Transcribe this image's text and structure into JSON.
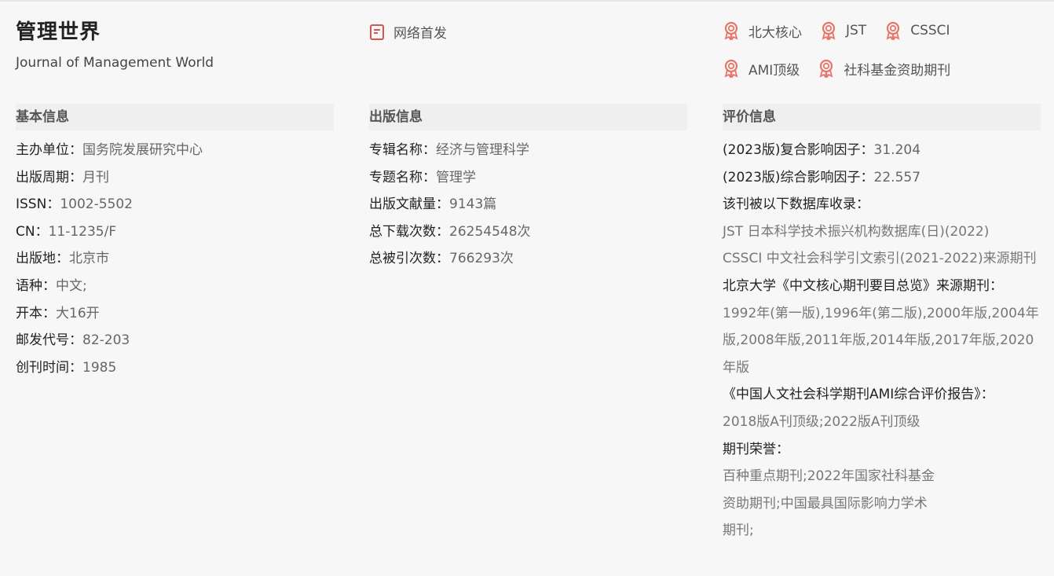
{
  "journal": {
    "title": "管理世界",
    "subtitle": "Journal of Management World",
    "network_first": "网络首发"
  },
  "badges": {
    "row1": [
      "北大核心",
      "JST",
      "CSSCI"
    ],
    "row2": [
      "AMI顶级",
      "社科基金资助期刊"
    ],
    "accent": "#e8756a"
  },
  "basic": {
    "heading": "基本信息",
    "items": [
      {
        "k": "主办单位：",
        "v": "国务院发展研究中心"
      },
      {
        "k": "出版周期：",
        "v": "月刊"
      },
      {
        "k": "ISSN：",
        "v": "1002-5502"
      },
      {
        "k": "CN：",
        "v": "11-1235/F"
      },
      {
        "k": "出版地：",
        "v": "北京市"
      },
      {
        "k": "语种：",
        "v": "中文;"
      },
      {
        "k": "开本：",
        "v": "大16开"
      },
      {
        "k": "邮发代号：",
        "v": "82-203"
      },
      {
        "k": "创刊时间：",
        "v": "1985"
      }
    ]
  },
  "publish": {
    "heading": "出版信息",
    "items": [
      {
        "k": "专辑名称：",
        "v": "经济与管理科学"
      },
      {
        "k": "专题名称：",
        "v": "管理学"
      },
      {
        "k": "出版文献量：",
        "v": "9143篇"
      },
      {
        "k": "总下载次数：",
        "v": "26254548次"
      },
      {
        "k": "总被引次数：",
        "v": "766293次"
      }
    ]
  },
  "evaluation": {
    "heading": "评价信息",
    "composite_if_k": "(2023版)复合影响因子：",
    "composite_if_v": "31.204",
    "comprehensive_if_k": "(2023版)综合影响因子：",
    "comprehensive_if_v": "22.557",
    "db_label": "该刊被以下数据库收录：",
    "db_jst": "JST 日本科学技术振兴机构数据库(日)(2022)",
    "db_cssci": "CSSCI 中文社会科学引文索引(2021-2022)来源期刊",
    "pku_label": "北京大学《中文核心期刊要目总览》来源期刊：",
    "pku_years": "1992年(第一版),1996年(第二版),2000年版,2004年版,2008年版,2011年版,2014年版,2017年版,2020年版",
    "ami_label": "《中国人文社会科学期刊AMI综合评价报告》：",
    "ami_value": "2018版A刊顶级;2022版A刊顶级",
    "honor_label": "期刊荣誉：",
    "honor_value": "百种重点期刊;2022年国家社科基金资助期刊;中国最具国际影响力学术期刊;"
  }
}
